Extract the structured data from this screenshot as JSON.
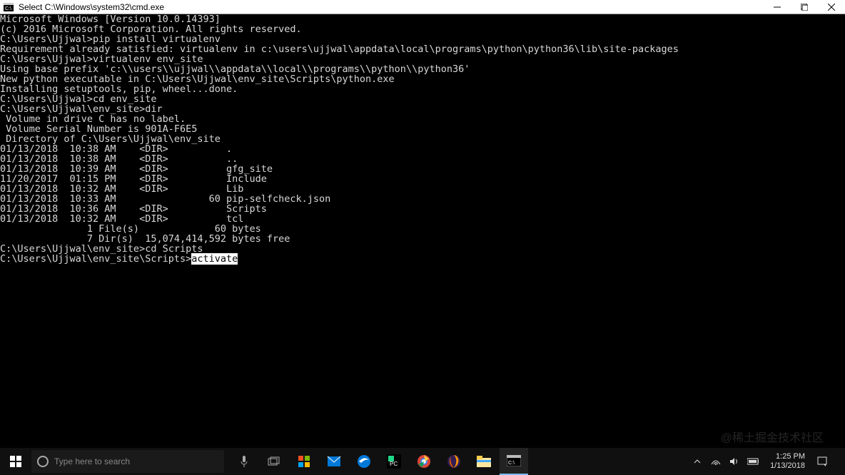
{
  "window": {
    "title": "Select C:\\Windows\\system32\\cmd.exe"
  },
  "terminal": {
    "lines": [
      "Microsoft Windows [Version 10.0.14393]",
      "(c) 2016 Microsoft Corporation. All rights reserved.",
      "",
      "C:\\Users\\Ujjwal>pip install virtualenv",
      "Requirement already satisfied: virtualenv in c:\\users\\ujjwal\\appdata\\local\\programs\\python\\python36\\lib\\site-packages",
      "",
      "C:\\Users\\Ujjwal>virtualenv env_site",
      "Using base prefix 'c:\\\\users\\\\ujjwal\\\\appdata\\\\local\\\\programs\\\\python\\\\python36'",
      "New python executable in C:\\Users\\Ujjwal\\env_site\\Scripts\\python.exe",
      "Installing setuptools, pip, wheel...done.",
      "",
      "C:\\Users\\Ujjwal>cd env_site",
      "",
      "C:\\Users\\Ujjwal\\env_site>dir",
      " Volume in drive C has no label.",
      " Volume Serial Number is 901A-F6E5",
      "",
      " Directory of C:\\Users\\Ujjwal\\env_site",
      "",
      "01/13/2018  10:38 AM    <DIR>          .",
      "01/13/2018  10:38 AM    <DIR>          ..",
      "01/13/2018  10:39 AM    <DIR>          gfg_site",
      "11/20/2017  01:15 PM    <DIR>          Include",
      "01/13/2018  10:32 AM    <DIR>          Lib",
      "01/13/2018  10:33 AM                60 pip-selfcheck.json",
      "01/13/2018  10:36 AM    <DIR>          Scripts",
      "01/13/2018  10:32 AM    <DIR>          tcl",
      "               1 File(s)             60 bytes",
      "               7 Dir(s)  15,074,414,592 bytes free",
      "",
      "C:\\Users\\Ujjwal\\env_site>cd Scripts",
      ""
    ],
    "last_prompt": "C:\\Users\\Ujjwal\\env_site\\Scripts>",
    "last_command_selected": "activate"
  },
  "taskbar": {
    "search_placeholder": "Type here to search"
  },
  "tray": {
    "time": "1:25 PM",
    "date": "1/13/2018"
  },
  "watermark": "@稀土掘金技术社区"
}
